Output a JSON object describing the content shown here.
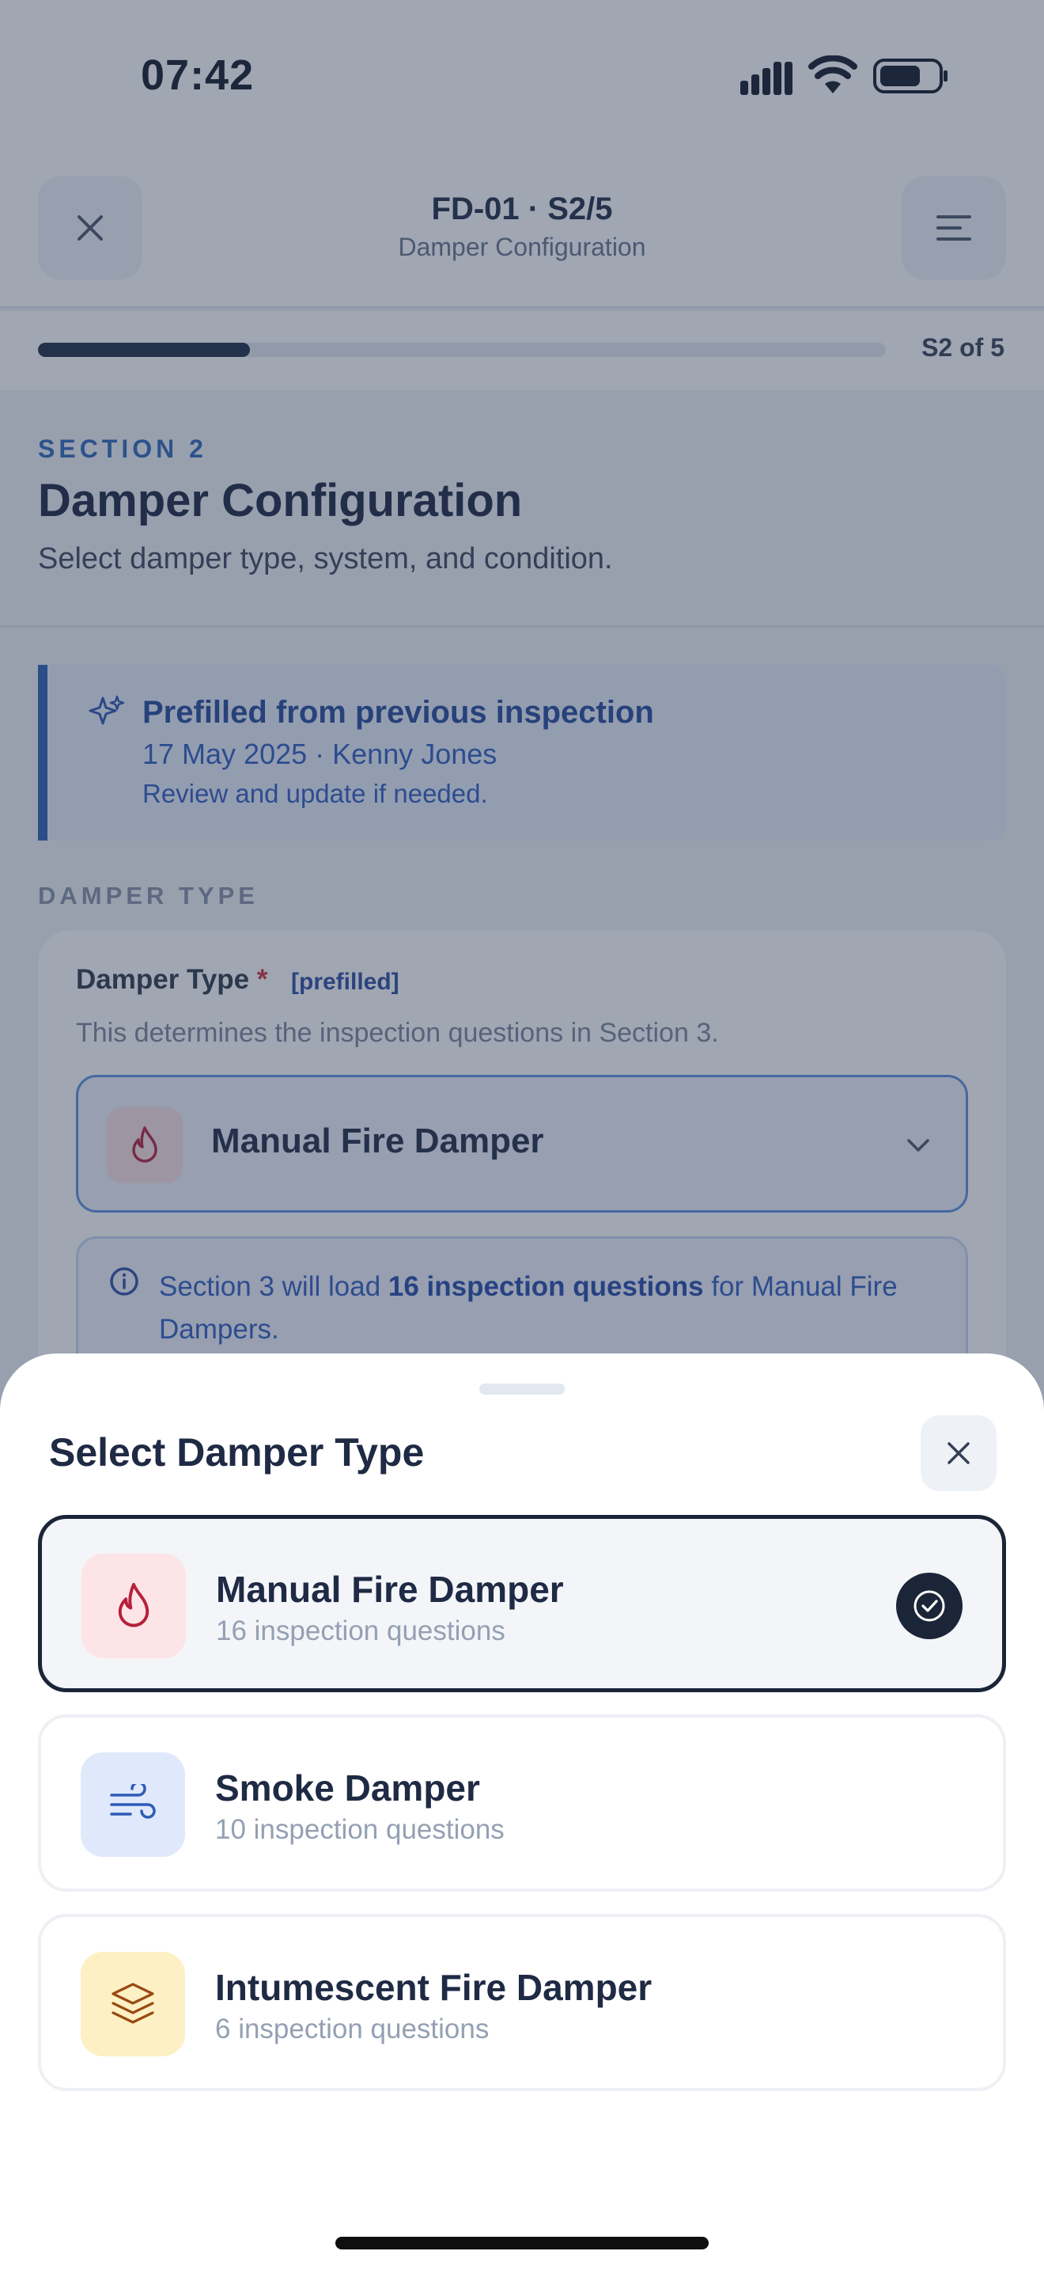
{
  "status_bar": {
    "time": "07:42"
  },
  "header": {
    "title": "FD-01 · S2/5",
    "subtitle": "Damper Configuration"
  },
  "progress": {
    "label": "S2 of 5",
    "fraction": 0.25
  },
  "section": {
    "eyebrow": "SECTION 2",
    "title": "Damper Configuration",
    "description": "Select damper type, system, and condition."
  },
  "prefill_banner": {
    "title": "Prefilled from previous inspection",
    "meta": "17 May 2025 · Kenny Jones",
    "note": "Review and update if needed."
  },
  "group_label": "DAMPER TYPE",
  "damper_field": {
    "label": "Damper Type",
    "required_mark": "*",
    "tag": "[prefilled]",
    "help": "This determines the inspection questions in Section 3.",
    "value": "Manual Fire Damper",
    "info": {
      "prefix": "Section 3 will load ",
      "emphasis": "16 inspection questions",
      "suffix": " for Manual Fire Dampers."
    }
  },
  "sheet": {
    "title": "Select Damper Type",
    "options": [
      {
        "name": "Manual Fire Damper",
        "sub": "16 inspection questions",
        "selected": true,
        "icon": "flame-icon",
        "icon_bg": "#fde4e6",
        "icon_color": "#b5203a"
      },
      {
        "name": "Smoke Damper",
        "sub": "10 inspection questions",
        "selected": false,
        "icon": "wind-icon",
        "icon_bg": "#dfe9fb",
        "icon_color": "#2f5bb7"
      },
      {
        "name": "Intumescent Fire Damper",
        "sub": "6 inspection questions",
        "selected": false,
        "icon": "layers-icon",
        "icon_bg": "#fdf0c4",
        "icon_color": "#9a4a12"
      }
    ]
  },
  "colors": {
    "accent": "#2b5fb3",
    "dark": "#1b2538",
    "danger": "#d1303a"
  }
}
